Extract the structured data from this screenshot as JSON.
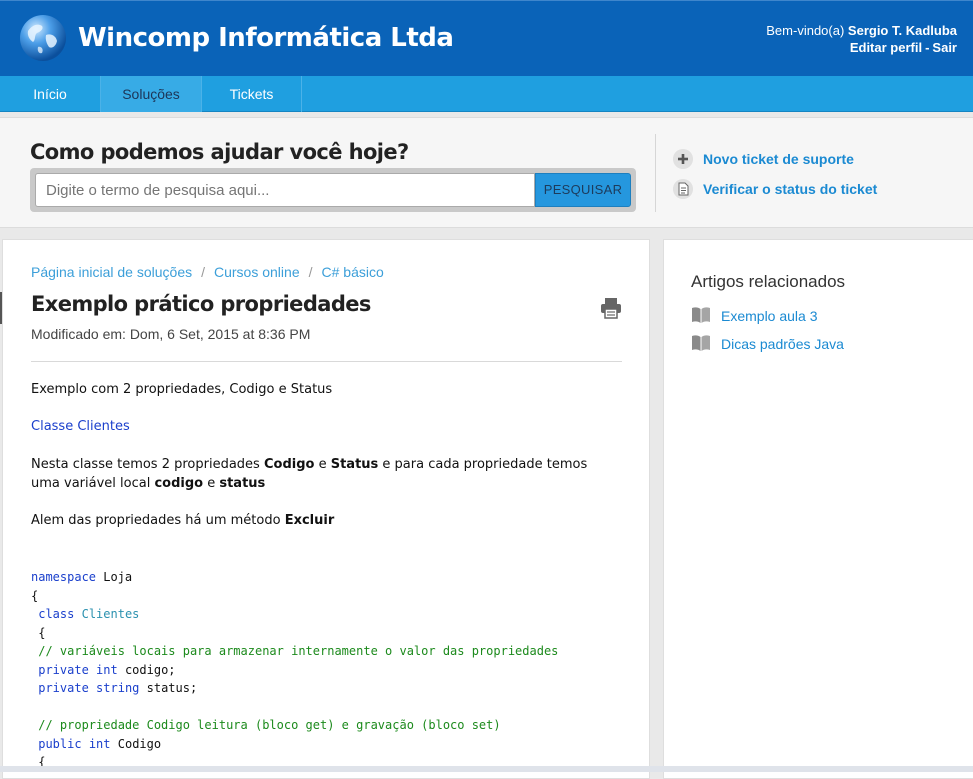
{
  "header": {
    "brand": "Wincomp Informática Ltda",
    "welcome_prefix": "Bem-vindo(a)",
    "user_name": "Sergio T. Kadluba",
    "edit_profile": "Editar perfil",
    "separator": "-",
    "logout": "Sair"
  },
  "nav": {
    "items": [
      {
        "label": "Início"
      },
      {
        "label": "Soluções"
      },
      {
        "label": "Tickets"
      }
    ],
    "active": "Soluções"
  },
  "search": {
    "title": "Como podemos ajudar você hoje?",
    "placeholder": "Digite o termo de pesquisa aqui...",
    "button": "PESQUISAR"
  },
  "quick_links": {
    "new_ticket": "Novo ticket de suporte",
    "check_status": "Verificar o status do ticket"
  },
  "breadcrumb": {
    "items": [
      "Página inicial de soluções",
      "Cursos online",
      "C# básico"
    ],
    "separator": "/"
  },
  "article": {
    "title": "Exemplo prático propriedades",
    "modified": "Modificado em: Dom, 6 Set, 2015 at 8:36 PM",
    "p1": "Exemplo com 2 propriedades, Codigo e Status",
    "link": "Classe Clientes",
    "p2_a": "Nesta classe temos 2 propriedades ",
    "p2_b": "Codigo",
    "p2_c": " e ",
    "p2_d": "Status",
    "p2_e": " e para cada propriedade temos uma variável local ",
    "p2_f": "codigo",
    "p2_g": " e ",
    "p2_h": "status",
    "p3_a": "Alem das propriedades há um método ",
    "p3_b": "Excluir"
  },
  "code": {
    "l1_kw": "namespace",
    "l1_rest": " Loja",
    "l2": "{",
    "l3_kw": "class",
    "l3_ty": "Clientes",
    "l4": "{",
    "l5_cm": "// variáveis locais para armazenar internamente o valor das propriedades",
    "l6_kw1": "private",
    "l6_kw2": "int",
    "l6_rest": " codigo;",
    "l7_kw1": "private",
    "l7_kw2": "string",
    "l7_rest": " status;",
    "l9_cm": "// propriedade Codigo leitura (bloco get) e gravação (bloco set)",
    "l10_kw1": "public",
    "l10_kw2": "int",
    "l10_rest": " Codigo",
    "l11": "{"
  },
  "related": {
    "title": "Artigos relacionados",
    "items": [
      "Exemplo aula 3",
      "Dicas padrões Java"
    ]
  },
  "colors": {
    "header_bg": "#0a63b8",
    "nav_bg": "#1f9fe0",
    "link": "#1b8ad2",
    "search_button": "#2597de"
  }
}
